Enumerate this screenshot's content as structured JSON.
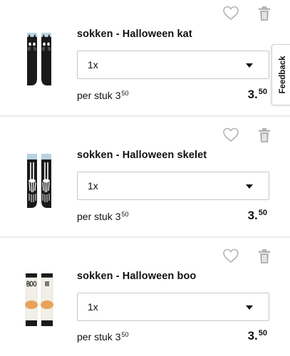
{
  "cart_items": [
    {
      "name": "sokken - Halloween kat",
      "quantity": "1x",
      "unit_label": "per stuk",
      "unit_price_int": "3",
      "unit_price_dec": "50",
      "total_int": "3.",
      "total_dec": "50",
      "thumbnail": "black-cat-socks"
    },
    {
      "name": "sokken - Halloween skelet",
      "quantity": "1x",
      "unit_label": "per stuk",
      "unit_price_int": "3",
      "unit_price_dec": "50",
      "total_int": "3.",
      "total_dec": "50",
      "thumbnail": "skeleton-socks"
    },
    {
      "name": "sokken - Halloween boo",
      "quantity": "1x",
      "unit_label": "per stuk",
      "unit_price_int": "3",
      "unit_price_dec": "50",
      "total_int": "3.",
      "total_dec": "50",
      "thumbnail": "boo-socks"
    }
  ],
  "icons": {
    "favorite": "heart-outline-icon",
    "remove": "trash-icon",
    "dropdown": "caret-down-icon"
  },
  "feedback_tab": {
    "label": "Feedback"
  },
  "colors": {
    "icon_gray": "#b3b3b3",
    "divider": "#ececec",
    "text": "#111111",
    "sock_black": "#1a1a1a",
    "sock_cuff_blue": "#b9d2e0",
    "boo_sock_white": "#f2efe6",
    "boo_heel_orange": "#e8a35a"
  }
}
